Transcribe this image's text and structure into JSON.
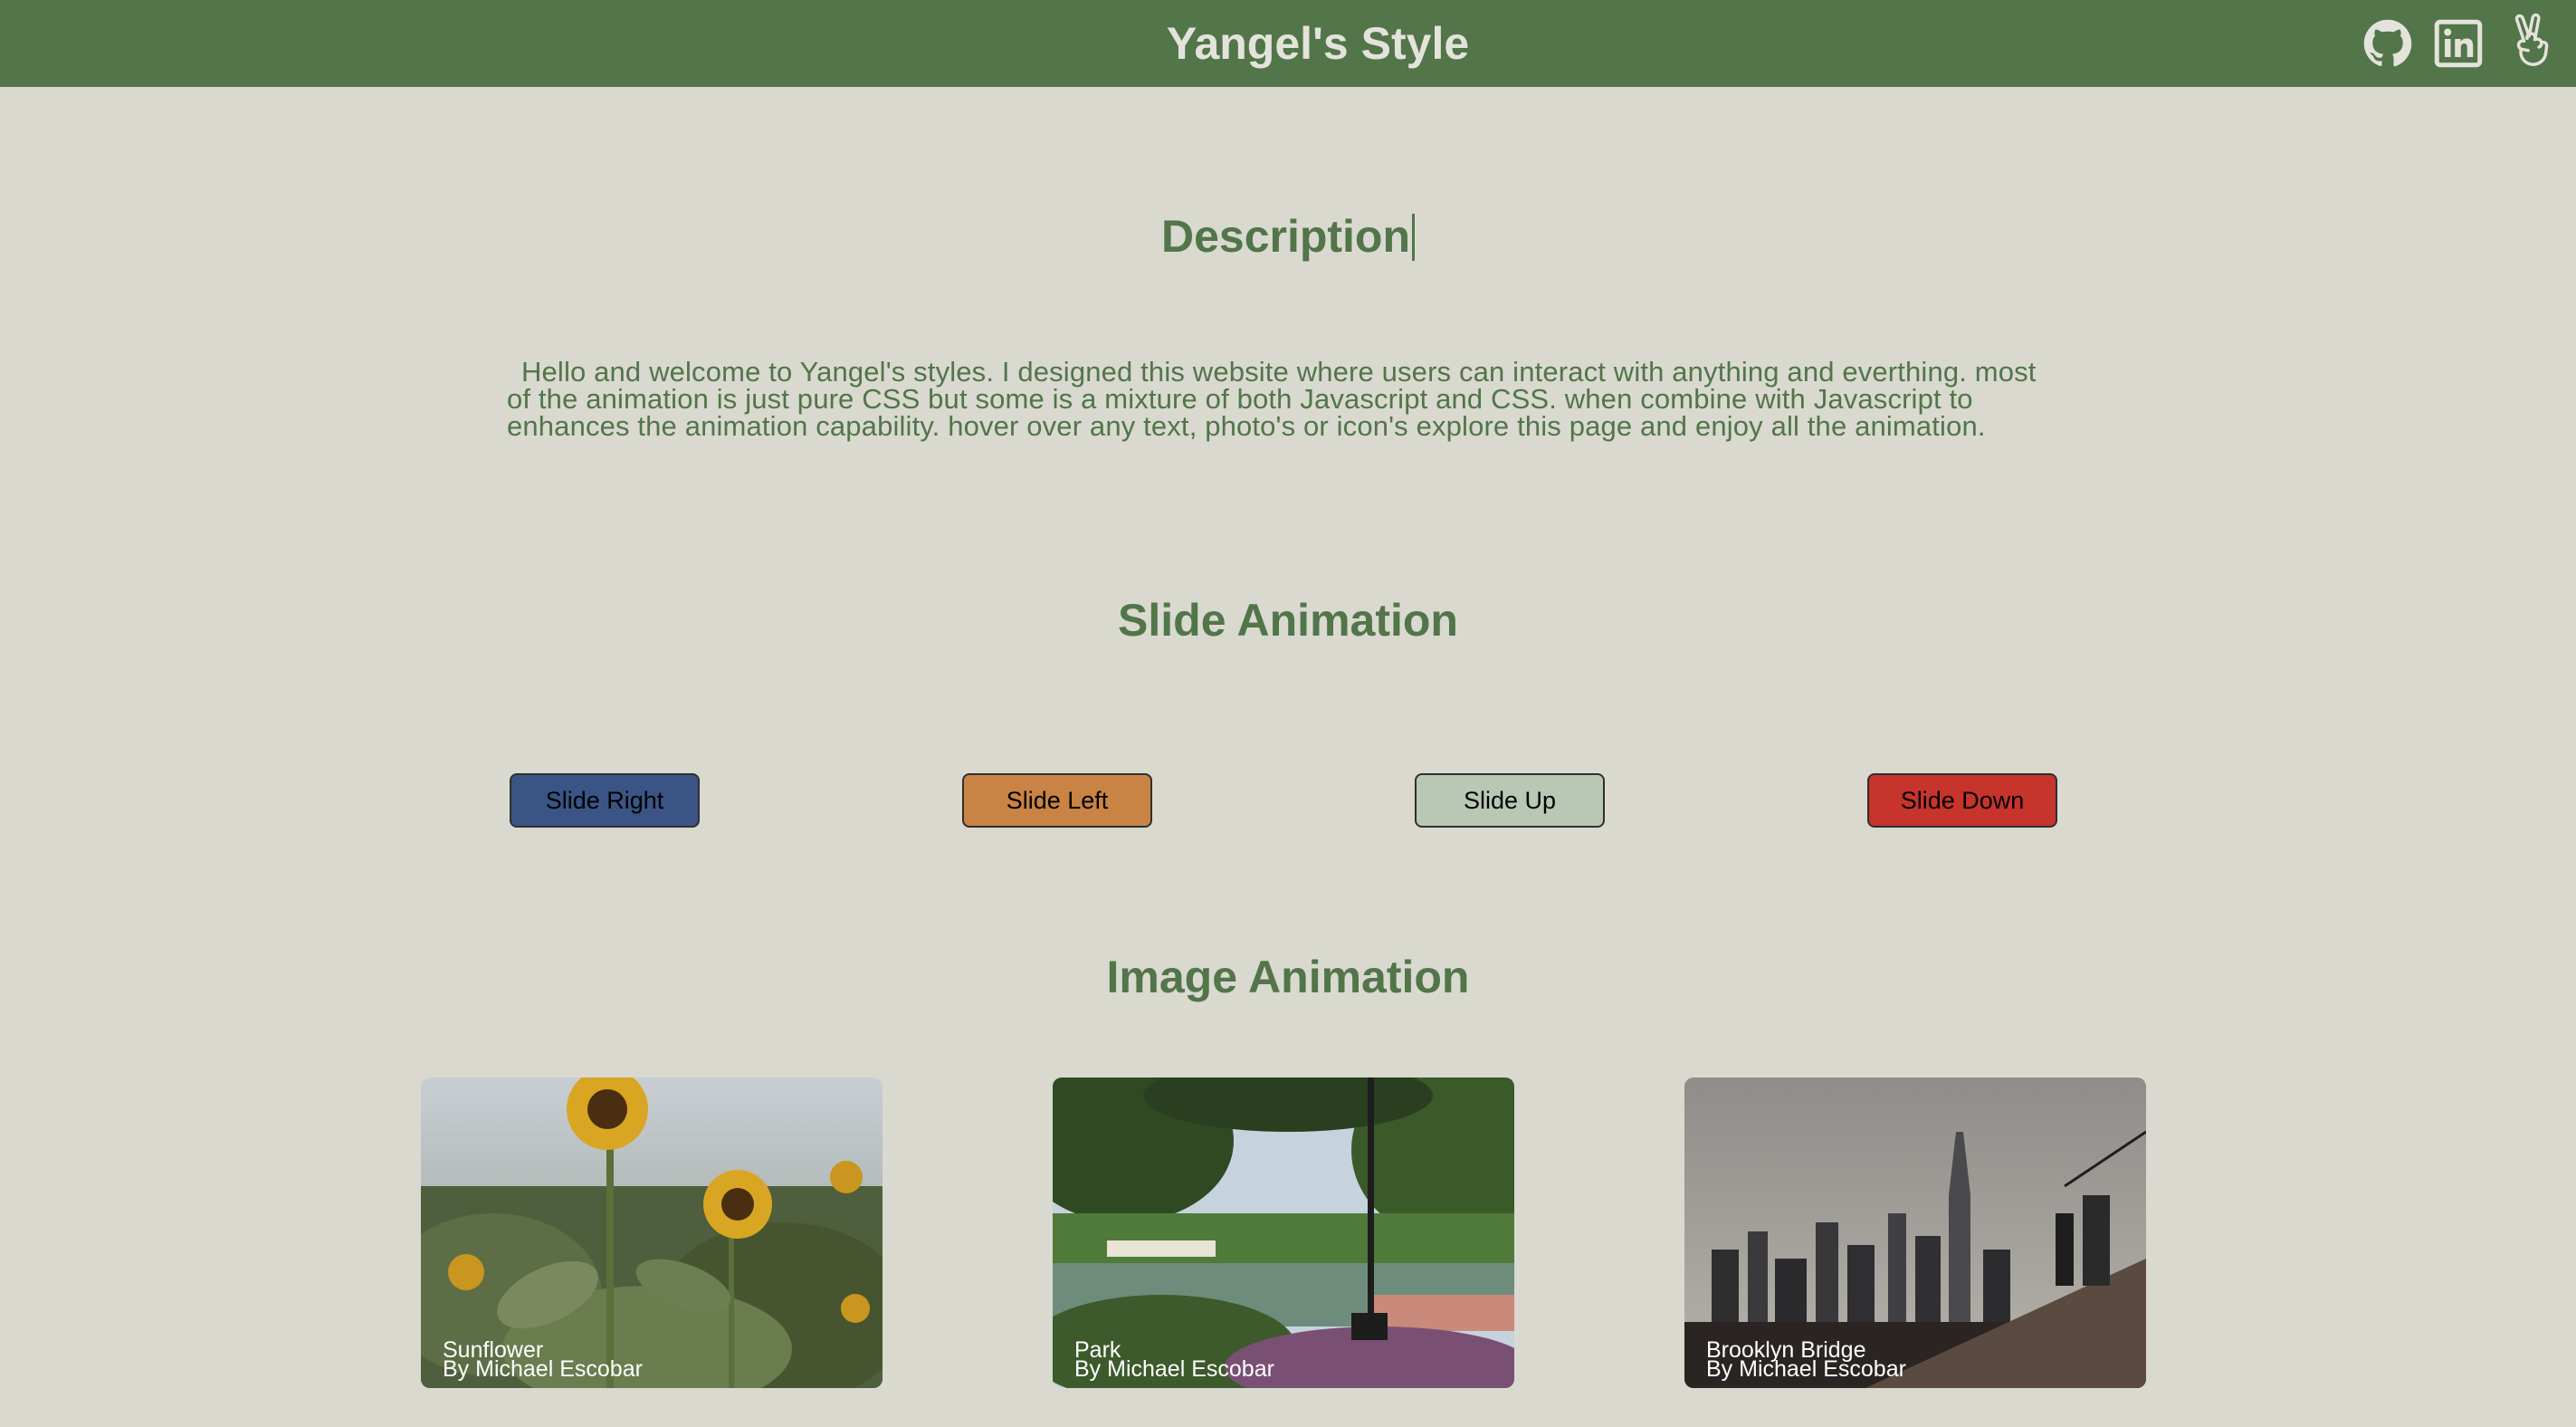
{
  "header": {
    "title": "Yangel's Style",
    "icons": [
      "github-icon",
      "linkedin-icon",
      "peace-hand-icon"
    ],
    "background": "#527549",
    "title_color": "#e3e3db"
  },
  "description": {
    "heading": "Description",
    "text": "Hello and welcome to Yangel's styles. I designed this website where users can interact with anything and everthing. most of the animation is just pure CSS but some is a mixture of both Javascript and CSS. when combine with Javascript to enhances the animation capability. hover over any text, photo's or icon's explore this page and enjoy all the animation."
  },
  "slide": {
    "heading": "Slide Animation",
    "buttons": [
      {
        "label": "Slide Right",
        "color": "#3a5585"
      },
      {
        "label": "Slide Left",
        "color": "#c98345"
      },
      {
        "label": "Slide Up",
        "color": "#b9c8b5"
      },
      {
        "label": "Slide Down",
        "color": "#c7342c"
      }
    ]
  },
  "images": {
    "heading": "Image Animation",
    "cards": [
      {
        "title": "Sunflower",
        "author": "By Michael Escobar"
      },
      {
        "title": "Park",
        "author": "By Michael Escobar"
      },
      {
        "title": "Brooklyn Bridge",
        "author": "By Michael Escobar"
      }
    ]
  },
  "colors": {
    "page_background": "#d9d9d0",
    "accent_green": "#527549"
  }
}
